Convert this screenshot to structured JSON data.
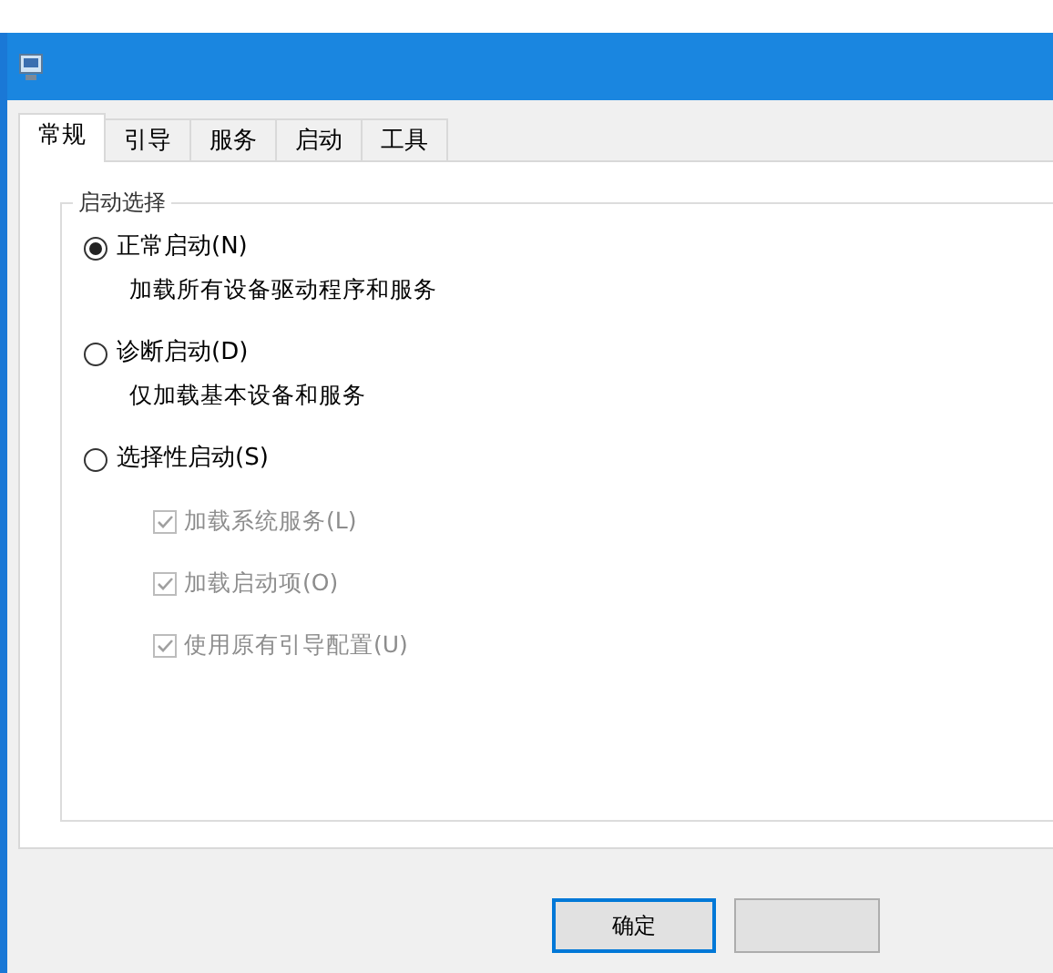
{
  "tabs": [
    {
      "label": "常规",
      "selected": true
    },
    {
      "label": "引导",
      "selected": false
    },
    {
      "label": "服务",
      "selected": false
    },
    {
      "label": "启动",
      "selected": false
    },
    {
      "label": "工具",
      "selected": false
    }
  ],
  "group": {
    "title": "启动选择",
    "options": [
      {
        "label": "正常启动(N)",
        "selected": true,
        "description": "加载所有设备驱动程序和服务"
      },
      {
        "label": "诊断启动(D)",
        "selected": false,
        "description": "仅加载基本设备和服务"
      },
      {
        "label": "选择性启动(S)",
        "selected": false
      }
    ],
    "checkboxes": [
      {
        "label": "加载系统服务(L)",
        "checked": true,
        "disabled": true
      },
      {
        "label": "加载启动项(O)",
        "checked": true,
        "disabled": true
      },
      {
        "label": "使用原有引导配置(U)",
        "checked": true,
        "disabled": true
      }
    ]
  },
  "buttons": [
    {
      "label": "确定",
      "default": true
    },
    {
      "default": false
    }
  ]
}
